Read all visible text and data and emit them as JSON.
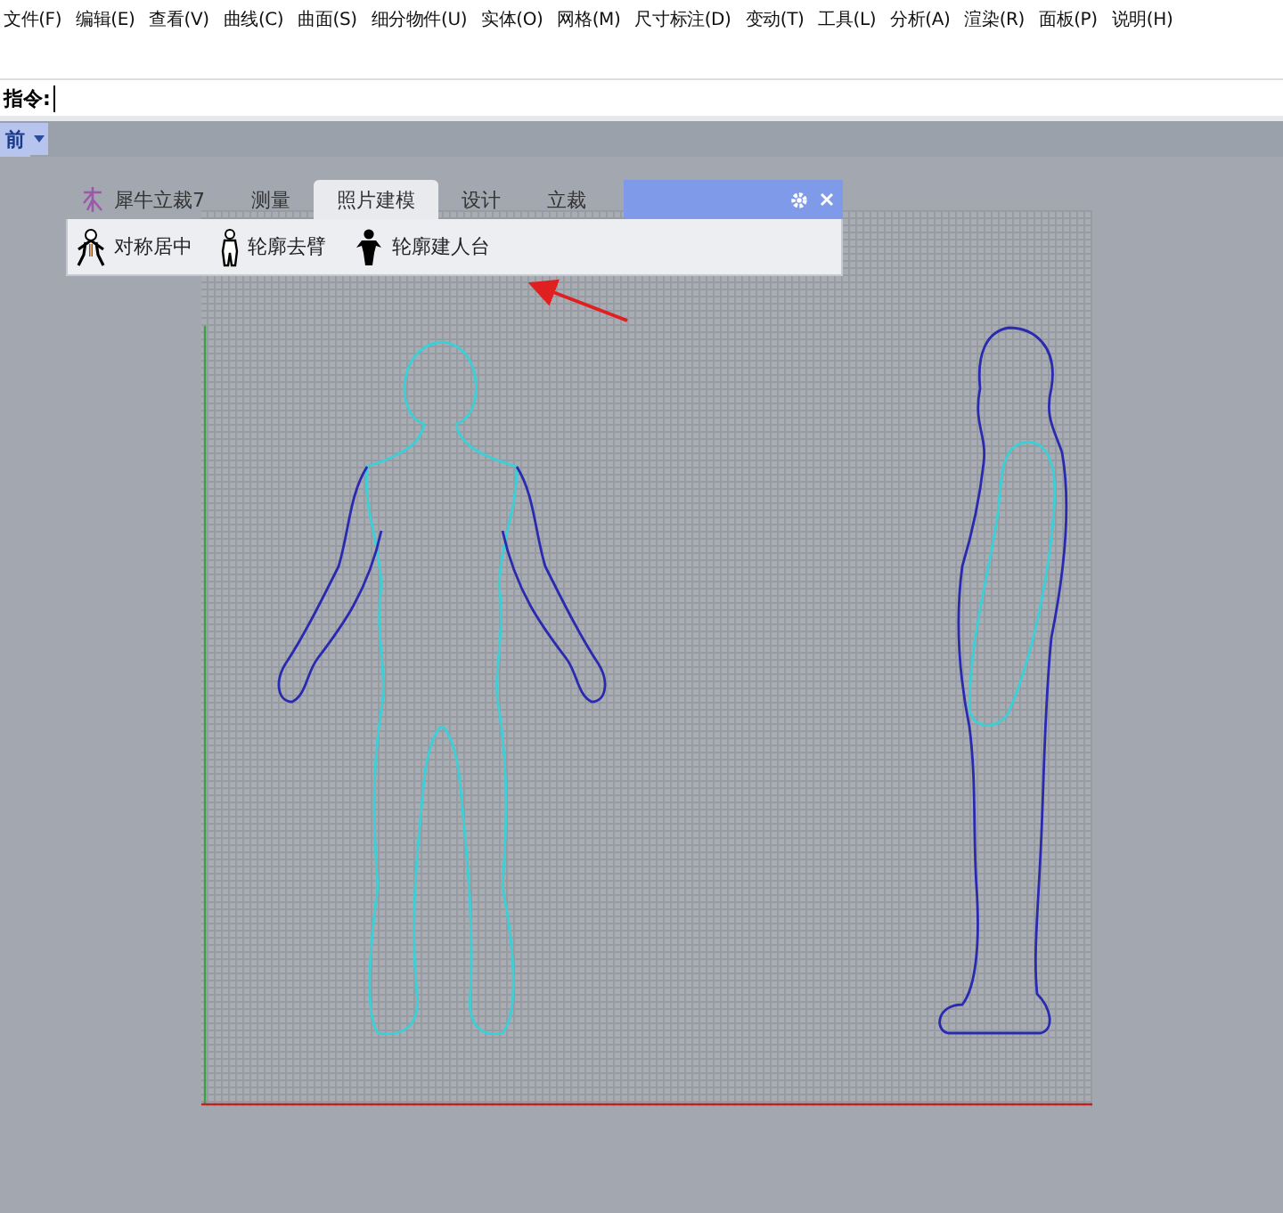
{
  "menu": [
    "文件(F)",
    "编辑(E)",
    "查看(V)",
    "曲线(C)",
    "曲面(S)",
    "细分物件(U)",
    "实体(O)",
    "网格(M)",
    "尺寸标注(D)",
    "变动(T)",
    "工具(L)",
    "分析(A)",
    "渲染(R)",
    "面板(P)",
    "说明(H)"
  ],
  "command": {
    "label": "指令:"
  },
  "viewport": {
    "name": "前"
  },
  "toolbar": {
    "tabs": [
      {
        "label": "犀牛立裁7",
        "selected": false
      },
      {
        "label": "测量",
        "selected": false
      },
      {
        "label": "照片建模",
        "selected": true
      },
      {
        "label": "设计",
        "selected": false
      },
      {
        "label": "立裁",
        "selected": false
      }
    ],
    "tools": [
      {
        "label": "对称居中"
      },
      {
        "label": "轮廓去臂"
      },
      {
        "label": "轮廓建人台"
      }
    ]
  }
}
